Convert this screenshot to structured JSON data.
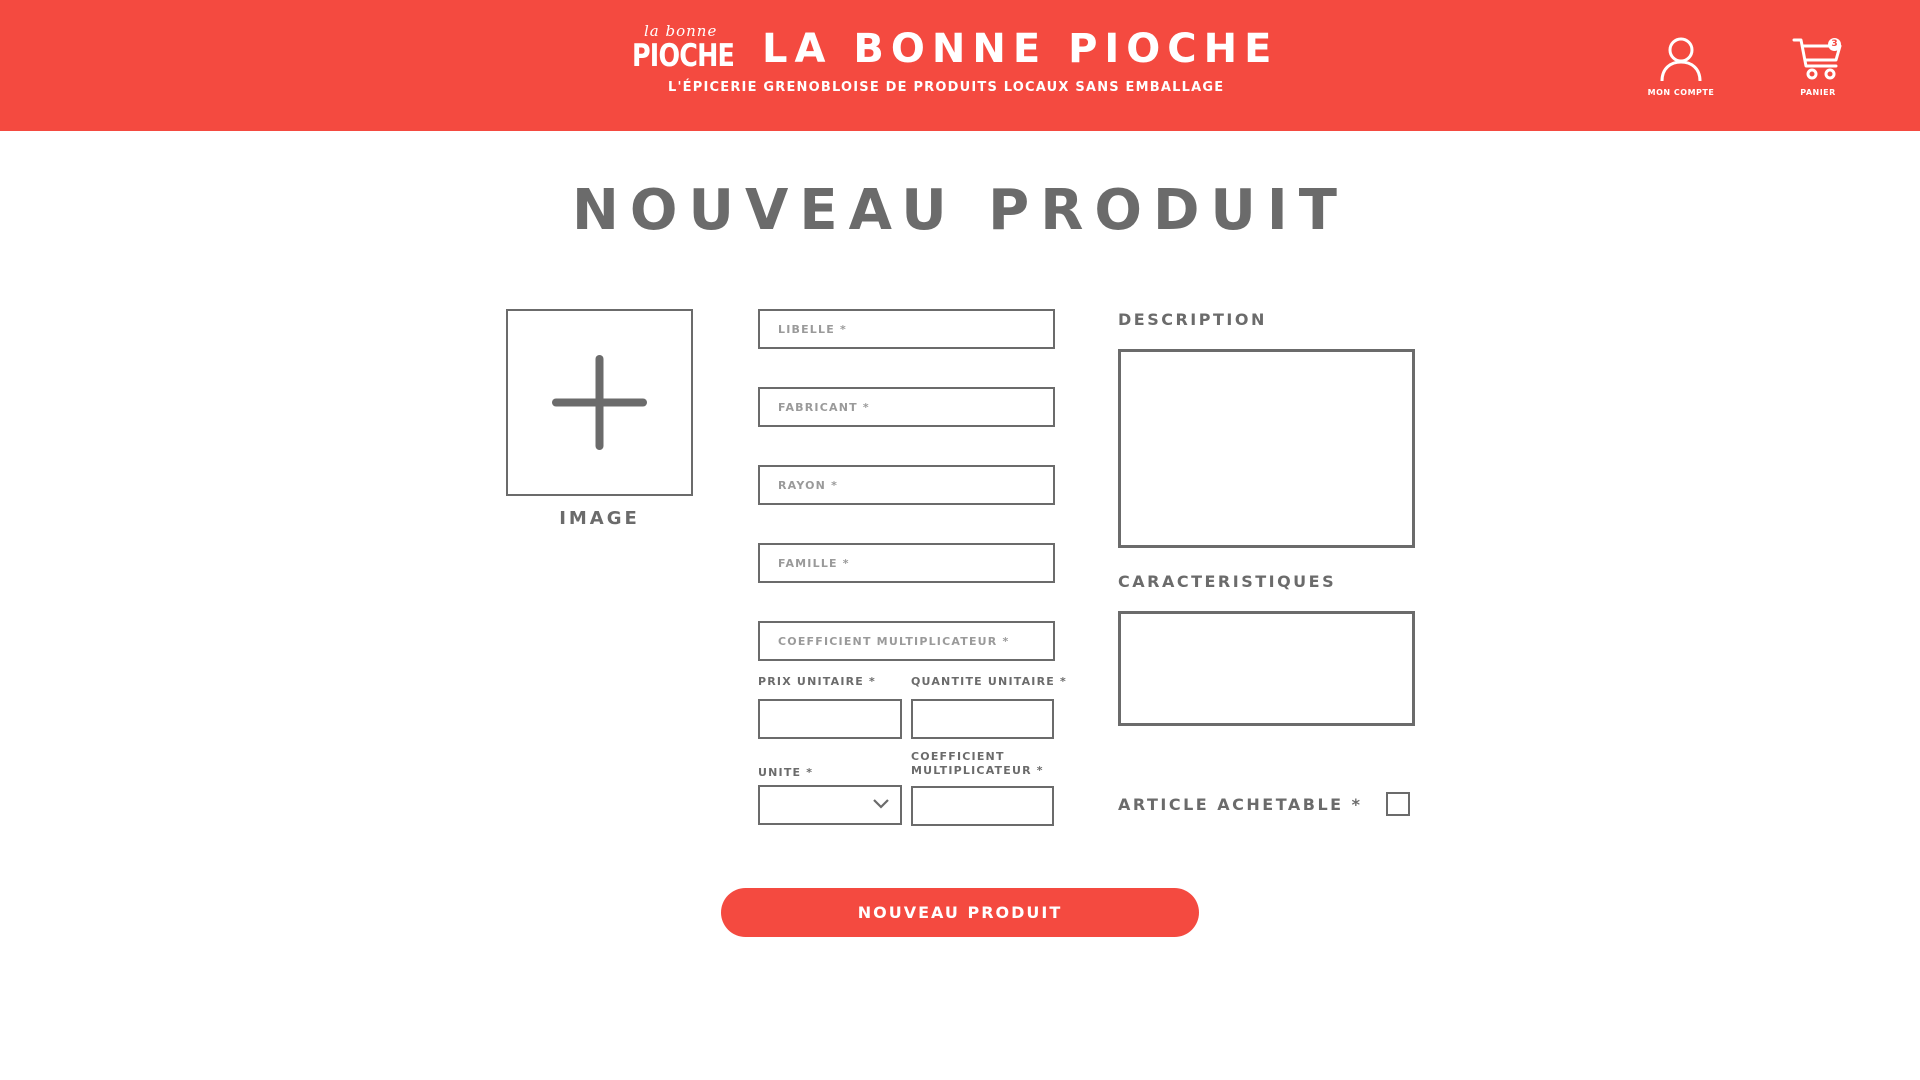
{
  "header": {
    "logo_small": "la bonne",
    "logo_big": "PIOCHE",
    "title": "LA BONNE PIOCHE",
    "subtitle": "L'ÉPICERIE GRENOBLOISE DE PRODUITS LOCAUX SANS EMBALLAGE",
    "account_label": "MON COMPTE",
    "cart_label": "PANIER",
    "cart_count": "3"
  },
  "page": {
    "title": "NOUVEAU PRODUIT"
  },
  "image": {
    "label": "IMAGE"
  },
  "form": {
    "libelle_placeholder": "LIBELLE *",
    "fabricant_placeholder": "FABRICANT *",
    "rayon_placeholder": "RAYON *",
    "famille_placeholder": "FAMILLE *",
    "coefficient_placeholder": "COEFFICIENT MULTIPLICATEUR *",
    "prix_unitaire_label": "PRIX UNITAIRE *",
    "quantite_unitaire_label": "QUANTITE UNITAIRE *",
    "unite_label": "UNITE *",
    "coefficient_label_line1": "COEFFICIENT",
    "coefficient_label_line2": "MULTIPLICATEUR *",
    "description_label": "DESCRIPTION",
    "caracteristiques_label": "CARACTERISTIQUES",
    "article_achetable_label": "ARTICLE ACHETABLE *",
    "submit_label": "NOUVEAU PRODUIT"
  },
  "colors": {
    "brand": "#f44a40",
    "text": "#6b6b6b"
  },
  "icons": {
    "account": "user-icon",
    "cart": "cart-icon",
    "image": "plus-icon",
    "select": "chevron-down-icon"
  }
}
